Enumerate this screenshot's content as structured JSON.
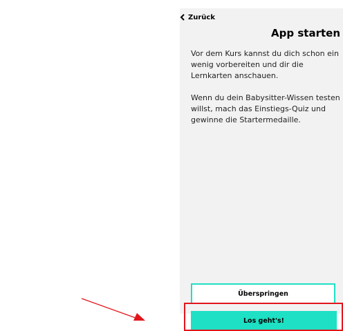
{
  "header": {
    "back_label": "Zurück",
    "title": "App starten"
  },
  "content": {
    "paragraph_1": "Vor dem Kurs kannst du dich schon ein wenig vorbereiten und dir die Lernkarten anschauen.",
    "paragraph_2": "Wenn du dein Babysitter-Wissen testen willst, mach das Einstiegs-Quiz und gewinne die Startermedaille."
  },
  "buttons": {
    "skip_label": "Überspringen",
    "start_label": "Los geht's!"
  },
  "colors": {
    "accent": "#1ee0c4",
    "annotation": "#e2151b",
    "screen_background": "#f2f2f2"
  },
  "icons": {
    "back": "chevron-left-icon"
  }
}
